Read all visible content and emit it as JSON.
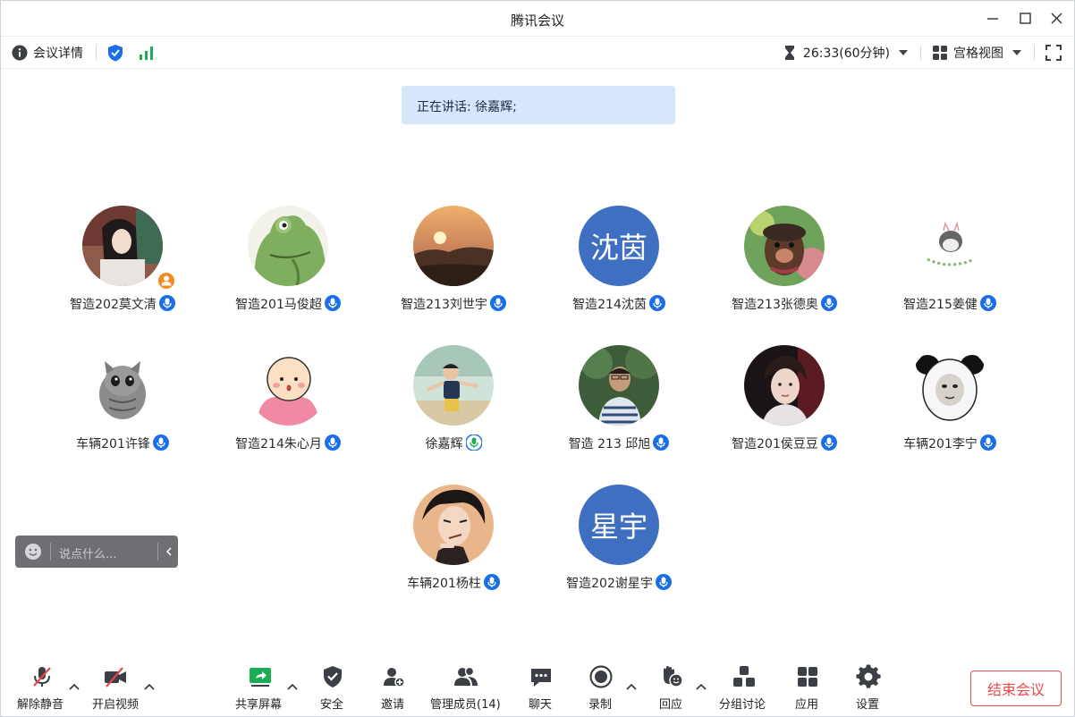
{
  "window": {
    "title": "腾讯会议"
  },
  "infobar": {
    "details_label": "会议详情",
    "timer": "26:33(60分钟)",
    "view_label": "宫格视图"
  },
  "speaking": {
    "text": "正在讲话: 徐嘉辉;"
  },
  "participants": [
    {
      "name": "智造202莫文清",
      "avatar": "photo-girl",
      "host": true
    },
    {
      "name": "智造201马俊超",
      "avatar": "frog"
    },
    {
      "name": "智造213刘世宇",
      "avatar": "sunset"
    },
    {
      "name": "智造214沈茵",
      "avatar": "initials",
      "initials": "沈茵"
    },
    {
      "name": "智造213张德奥",
      "avatar": "dog"
    },
    {
      "name": "智造215姜健",
      "avatar": "sketch"
    },
    {
      "name": "车辆201许锋",
      "avatar": "kitten"
    },
    {
      "name": "智造214朱心月",
      "avatar": "cartoon-blush"
    },
    {
      "name": "徐嘉辉",
      "avatar": "photo-boy",
      "speaking": true
    },
    {
      "name": "智造 213 邱旭",
      "avatar": "photo-man"
    },
    {
      "name": "智造201侯豆豆",
      "avatar": "photo-dark"
    },
    {
      "name": "车辆201李宁",
      "avatar": "panda-meme"
    },
    {
      "name": "车辆201杨柱",
      "avatar": "anime"
    },
    {
      "name": "智造202谢星宇",
      "avatar": "initials",
      "initials": "星宇"
    }
  ],
  "chat": {
    "placeholder": "说点什么..."
  },
  "toolbar": {
    "unmute": "解除静音",
    "start_video": "开启视频",
    "share_screen": "共享屏幕",
    "security": "安全",
    "invite": "邀请",
    "manage_members": "管理成员(14)",
    "chat": "聊天",
    "record": "录制",
    "reactions": "回应",
    "breakout": "分组讨论",
    "apps": "应用",
    "settings": "设置",
    "end_meeting": "结束会议"
  },
  "colors": {
    "accent_blue": "#1a6fe8",
    "speaking_green": "#1aad55",
    "end_red": "#e5484d",
    "banner_bg": "#d7e7fb",
    "initials_bg": "#3e6fc1"
  }
}
